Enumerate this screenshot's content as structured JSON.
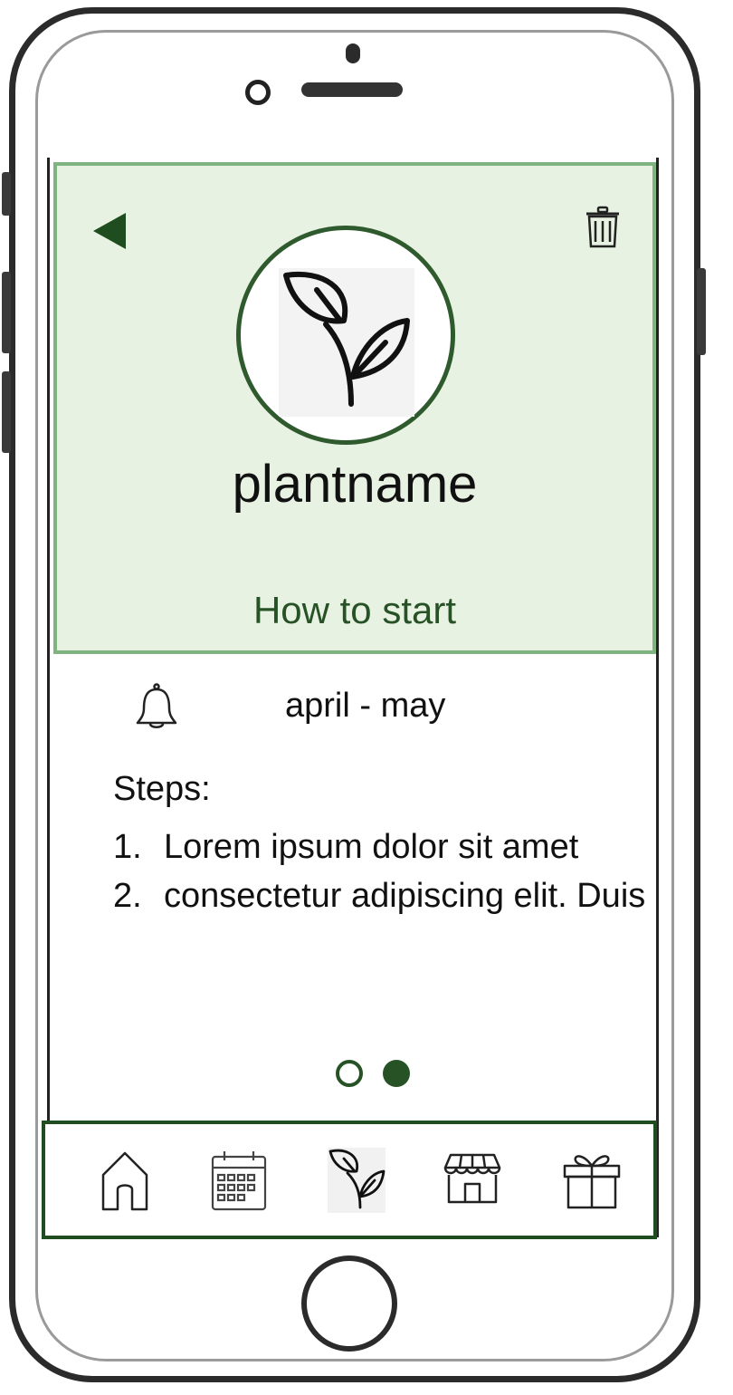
{
  "header": {
    "plant_name": "plantname",
    "section_title": "How to start",
    "back_icon": "back-arrow-icon",
    "delete_icon": "trash-icon",
    "avatar_icon": "sprout-icon"
  },
  "schedule": {
    "icon": "bell-icon",
    "period": "april - may"
  },
  "steps": {
    "title": "Steps:",
    "items": [
      {
        "num": "1.",
        "text": "Lorem ipsum dolor sit amet"
      },
      {
        "num": "2.",
        "text": "consectetur adipiscing elit. Duis"
      }
    ]
  },
  "pagination": {
    "total": 2,
    "active": 2
  },
  "bottom_nav": {
    "items": [
      {
        "icon": "home-icon"
      },
      {
        "icon": "calendar-icon"
      },
      {
        "icon": "plant-icon",
        "active": true
      },
      {
        "icon": "shop-icon"
      },
      {
        "icon": "gift-icon"
      }
    ]
  },
  "colors": {
    "header_bg": "#e8f2e2",
    "header_border": "#7fb37f",
    "accent_dark_green": "#265226"
  }
}
